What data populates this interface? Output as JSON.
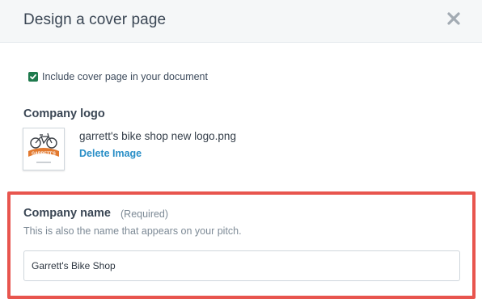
{
  "dialog": {
    "title": "Design a cover page",
    "close_icon": "close-icon"
  },
  "cover_option": {
    "checked": true,
    "label": "Include cover page in your document",
    "accent_color": "#1f7a4d"
  },
  "logo": {
    "label": "Company logo",
    "file_name": "garrett's bike shop new logo.png",
    "delete_label": "Delete Image",
    "logo_text": "GARRETT'S",
    "logo_color": "#e2792f"
  },
  "company_name": {
    "label": "Company name",
    "required_label": "(Required)",
    "hint": "This is also the name that appears on your pitch.",
    "value": "Garrett's Bike Shop",
    "highlight_color": "#e8554e"
  }
}
